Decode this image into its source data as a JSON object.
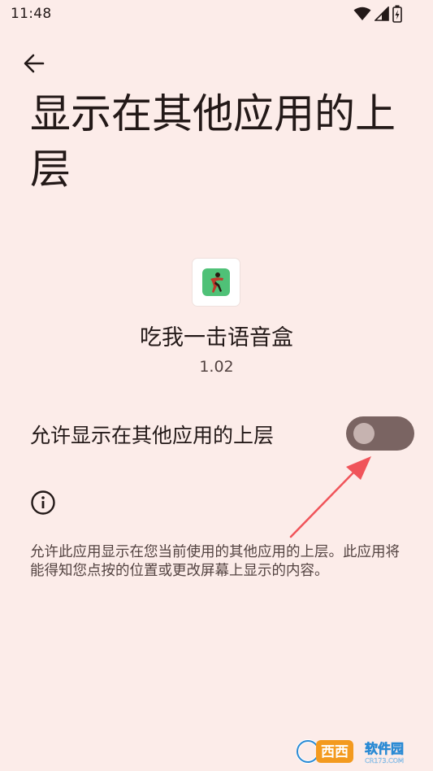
{
  "status_bar": {
    "time": "11:48",
    "icons": [
      "wifi-icon",
      "signal-icon",
      "battery-charging-icon"
    ]
  },
  "header": {
    "back_icon": "arrow-left-icon",
    "title": "显示在其他应用的上层"
  },
  "app": {
    "name": "吃我一击语音盒",
    "version": "1.02",
    "icon_color": "#4fc177"
  },
  "permission": {
    "label": "允许显示在其他应用的上层",
    "enabled": false,
    "track_color": "#7a6462",
    "thumb_color": "#c6b3b0"
  },
  "info": {
    "icon": "info-icon",
    "description": "允许此应用显示在您当前使用的其他应用的上层。此应用将能得知您点按的位置或更改屏幕上显示的内容。"
  },
  "annotation": {
    "arrow_color": "#f0545a"
  },
  "watermark": {
    "text": "西西软件园",
    "sub": "CR173.COM"
  }
}
